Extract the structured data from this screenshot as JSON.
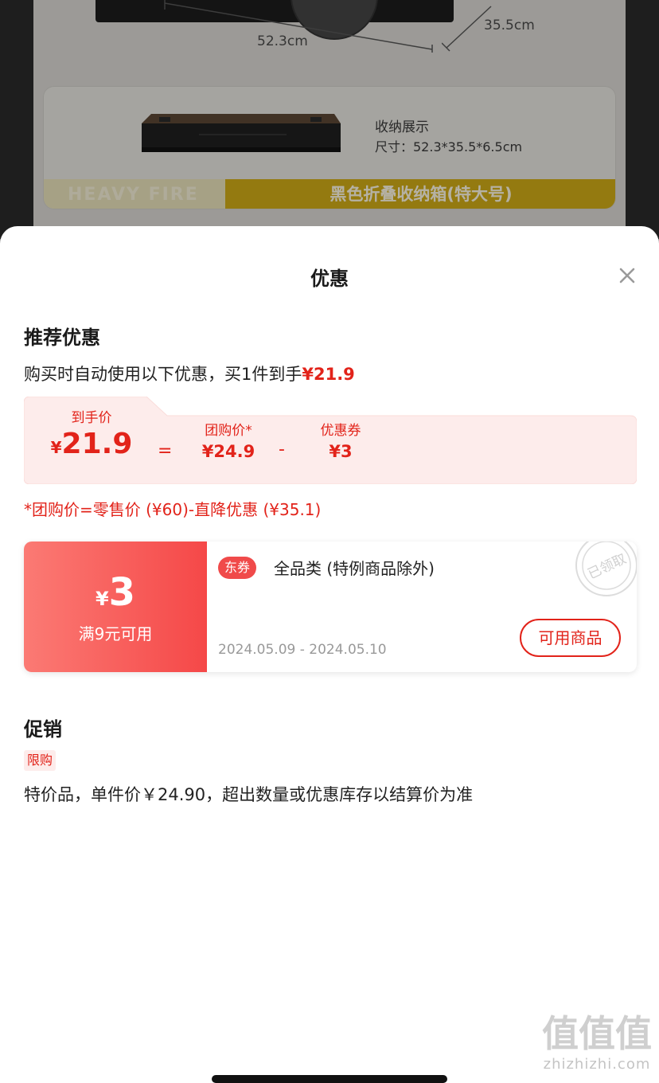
{
  "background": {
    "width_label": "52.3cm",
    "depth_label": "35.5cm",
    "display_title": "收纳展示",
    "display_size": "尺寸：52.3*35.5*6.5cm",
    "banner_left": "HEAVY FIRE",
    "banner_right": "黑色折叠收纳箱(特大号)"
  },
  "sheet": {
    "title": "优惠",
    "close_icon": "close-icon",
    "recommend": {
      "title": "推荐优惠",
      "desc_prefix": "购买时自动使用以下优惠，买1件到手",
      "desc_price": "¥21.9",
      "final_label": "到手价",
      "final_currency": "¥",
      "final_value": "21.9",
      "equals": "=",
      "group_label": "团购价*",
      "group_value": "¥24.9",
      "minus": "-",
      "coupon_label": "优惠券",
      "coupon_value": "¥3",
      "formula": "*团购价=零售价 (¥60)-直降优惠 (¥35.1)"
    },
    "coupon": {
      "currency": "¥",
      "amount": "3",
      "condition": "满9元可用",
      "tag": "东券",
      "scope": "全品类 (特例商品除外)",
      "date": "2024.05.09 - 2024.05.10",
      "button": "可用商品",
      "stamp": "已领取"
    },
    "promo": {
      "title": "促销",
      "badge": "限购",
      "text": "特价品，单件价￥24.90，超出数量或优惠库存以结算价为准"
    }
  },
  "watermark": {
    "logo": "值值值",
    "url": "zhizhizhi.com"
  },
  "colors": {
    "accent_red": "#e2231a",
    "coupon_gradient_start": "#fb7a74",
    "coupon_gradient_end": "#f54848",
    "price_panel_bg": "#fdeceb"
  }
}
